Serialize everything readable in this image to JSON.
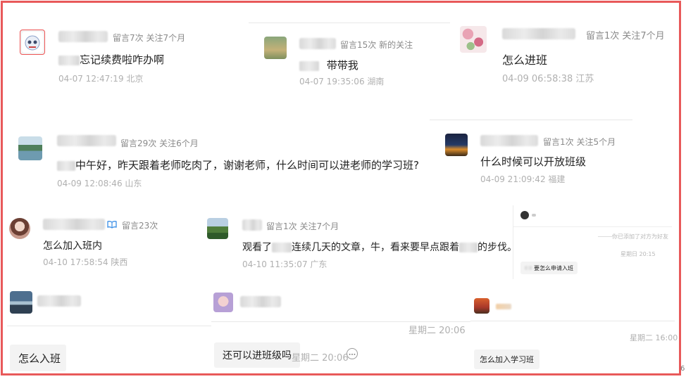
{
  "colors": {
    "frame_border": "#e8595a",
    "meta_text": "#8a8a8a",
    "time_text": "#b0b0b0",
    "verified_blue": "#3a8ee6"
  },
  "comments": [
    {
      "meta": "留言7次 关注7个月",
      "text": "忘记续费啦咋办啊",
      "time": "04-07 12:47:19 北京"
    },
    {
      "meta": "留言15次 新的关注",
      "text": "带带我",
      "time": "04-07 19:35:06 湖南"
    },
    {
      "meta": "留言1次 关注7个月",
      "text": "怎么进班",
      "time": "04-09 06:58:38 江苏"
    },
    {
      "meta": "留言29次 关注6个月",
      "text": "中午好，昨天跟着老师吃肉了，谢谢老师，什么时间可以进老师的学习班?",
      "time": "04-09 12:08:46 山东"
    },
    {
      "meta": "留言1次 关注5个月",
      "text": "什么时候可以开放班级",
      "time": "04-09 21:09:42 福建"
    },
    {
      "meta": "留言23次",
      "text": "怎么加入班内",
      "time": "04-10 17:58:54 陕西"
    },
    {
      "meta": "留言1次 关注7个月",
      "text_before": "观看了",
      "text_mid": "连续几天的文章，牛，看来要早点跟着",
      "text_after": "的步伐。",
      "time": "04-10 11:35:07 广东"
    }
  ],
  "mini_chat": {
    "system_line": "你已添加了对方为好友",
    "time": "星期日 20:15",
    "bubble": "要怎么申请入班"
  },
  "chats": [
    {
      "bubble": "怎么入班"
    },
    {
      "time": "星期二 20:06",
      "bubble": "还可以进班级吗",
      "side_time": "星期二 20:06"
    },
    {
      "time": "星期二 16:00",
      "bubble": "怎么加入学习班"
    }
  ],
  "edge_char": "6"
}
